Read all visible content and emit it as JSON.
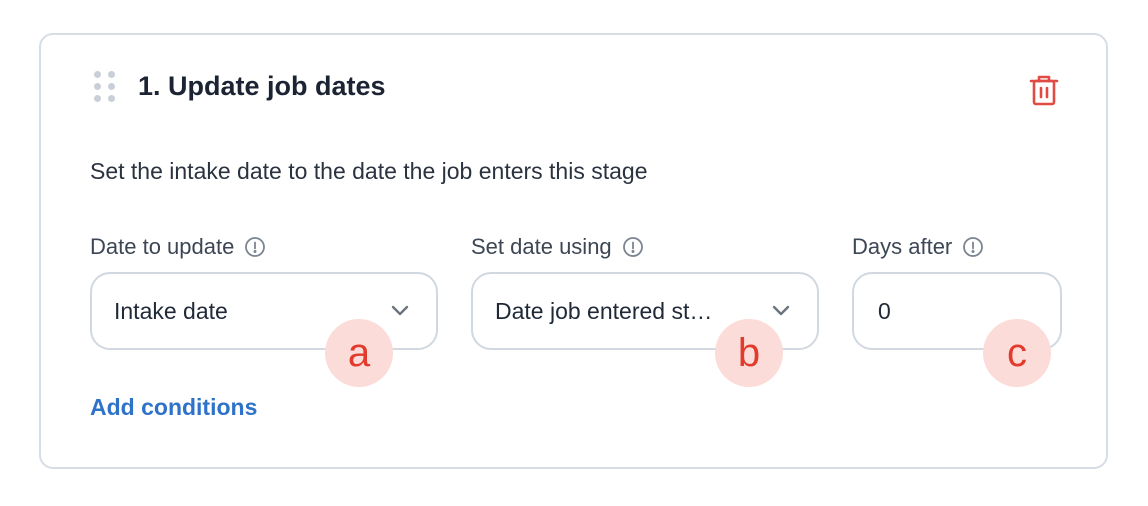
{
  "action": {
    "title": "1. Update job dates",
    "description": "Set the intake date to the date the job enters this stage",
    "add_conditions_label": "Add conditions"
  },
  "fields": {
    "date_to_update": {
      "label": "Date to update",
      "value": "Intake date",
      "badge": "a"
    },
    "set_date_using": {
      "label": "Set date using",
      "value": "Date job entered st…",
      "badge": "b"
    },
    "days_after": {
      "label": "Days after",
      "value": "0",
      "badge": "c"
    }
  },
  "icons": {
    "drag": "drag-handle-icon",
    "delete": "trash-icon",
    "info": "info-icon",
    "dropdown": "chevron-down-icon"
  },
  "colors": {
    "delete_icon": "#e04b43",
    "link": "#2f73c9",
    "badge_bg": "#fbdcd8",
    "badge_text": "#e23b2e",
    "border": "#d2d8e0"
  }
}
